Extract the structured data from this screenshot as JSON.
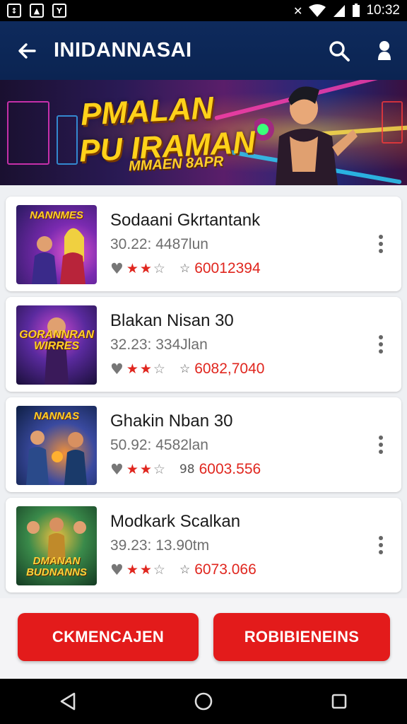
{
  "status_bar": {
    "time": "10:32",
    "left_icons": [
      "notification-icon",
      "image-icon",
      "app-icon"
    ],
    "right_icons": [
      "mute-icon",
      "wifi-icon",
      "signal-icon",
      "battery-icon"
    ]
  },
  "app_bar": {
    "title": "INIDANNASAI",
    "back_icon": "arrow-left-icon",
    "search_icon": "search-icon",
    "profile_icon": "person-icon"
  },
  "banner": {
    "line1": "PMALAN",
    "line2": "PU IRAMAN",
    "subline": "MMAEN 8APR"
  },
  "items": [
    {
      "title": "Sodaani Gkrtantank",
      "subtitle": "30.22: 4487lun",
      "rating": 2,
      "meta_prefix": "☆",
      "code": "60012394",
      "thumb_text": "NANNMES",
      "thumb_colors": [
        "#5b2ba6",
        "#c23bb0",
        "#2a1a60"
      ]
    },
    {
      "title": "Blakan Nisan 30",
      "subtitle": "32.23: 334Jlan",
      "rating": 2,
      "meta_prefix": "☆",
      "code": "6082,7040",
      "thumb_text": "GORANNRAN WIRRES",
      "thumb_colors": [
        "#2d1a6e",
        "#8a2a9e",
        "#1a0f3a"
      ]
    },
    {
      "title": "Ghakin Nban 30",
      "subtitle": "50.92: 4582lan",
      "rating": 2,
      "meta_prefix": "98",
      "code": "6003.556",
      "thumb_text": "NANNAS",
      "thumb_colors": [
        "#1d3a7a",
        "#c8602a",
        "#0e1f44"
      ]
    },
    {
      "title": "Modkark Scalkan",
      "subtitle": "39.23: 13.90tm",
      "rating": 2,
      "meta_prefix": "☆",
      "code": "6073.066",
      "thumb_text": "DMANAN BUDNANNS",
      "thumb_colors": [
        "#2b6a3a",
        "#d89a2a",
        "#143a22"
      ]
    }
  ],
  "buttons": {
    "left": "CKMENCAJEN",
    "right": "ROBIBIENEINS"
  },
  "colors": {
    "app_bar": "#0e2a5c",
    "accent_red": "#e31b1b",
    "banner_gold": "#ffd21a"
  }
}
